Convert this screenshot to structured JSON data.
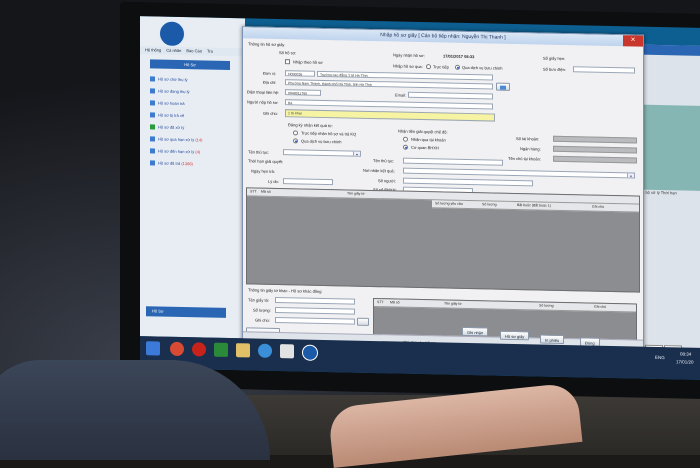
{
  "app": {
    "title": "",
    "menu": [
      "Hệ thống",
      "Cá nhân",
      "Báo Cáo",
      "Tra"
    ],
    "panel_title": "Hồ Sơ",
    "nav_items": [
      {
        "label": "Hồ sơ chờ thụ lý"
      },
      {
        "label": "Hồ sơ đang thụ lý"
      },
      {
        "label": "Hồ sơ hoàn trả"
      },
      {
        "label": "Hồ sơ bị trả về"
      },
      {
        "label": "Hồ sơ đã xử lý"
      },
      {
        "label": "Hồ sơ quá hạn xử lý",
        "badge": "(14)"
      },
      {
        "label": "Hồ sơ đến hạn xử lý",
        "badge": "(4)"
      },
      {
        "label": "Hồ sơ đã trả",
        "badge": "(1366)"
      }
    ],
    "bottom_label": "Hồ Sơ"
  },
  "dialog": {
    "title": "Nhập hồ sơ giấy [ Cán bộ tiếp nhận: Nguyễn Thị Thanh ]",
    "close": "✕",
    "section_info": "Thông tin hồ sơ giấy",
    "so_ho_so_label": "Số hồ sơ:",
    "ngay_nhan_label": "Ngày nhận hồ sơ:",
    "ngay_nhan_value": "17/01/2017 08:33",
    "so_giay_hen_label": "Số giấy hẹn:",
    "nhap_theo_label": "Nhập theo hồ sơ",
    "nhap_hs_qua_label": "Nhập hồ sơ qua:",
    "truc_tiep": "Trực tiếp",
    "qua_dich_vu": "Qua dịch vụ bưu chính",
    "so_buu_dien_label": "Số bưu điện:",
    "don_vi_label": "Đơn vị:",
    "don_vi_code": "H050026",
    "don_vi_name": "Trường cao đẳng Y tế Hà Tĩnh",
    "dia_chi_label": "Địa chỉ:",
    "dia_chi_value": "Phường Nam Thành, thành phố Hà Tĩnh, tỉnh Hà Tĩnh",
    "dien_thoai_label": "Điện thoại liên hệ:",
    "dien_thoai_value": "0948011765",
    "email_label": "Email:",
    "nguoi_nop_label": "Người nộp hồ sơ:",
    "nguoi_nop_value": "Bà",
    "ghi_chu_label": "Ghi chú:",
    "ghi_chu_value": "1 tờ khai",
    "dang_ky_label": "Đăng ký nhận kết quả từ:",
    "opt_truc_tiep_nhan": "Trực tiếp nhận hồ sơ và trả KQ",
    "opt_qua_dich_vu": "Qua dịch vụ bưu chính",
    "nhan_tien_label": "Nhận tiền giải quyết chế độ:",
    "opt_nhan_qua_tk": "Nhận qua tài khoản",
    "opt_co_quan": "Cơ quan BHXH",
    "so_tai_khoan_label": "Số tài khoản:",
    "ngan_hang_label": "Ngân hàng:",
    "ten_chu_tk_label": "Tên chủ tài khoản:",
    "ten_thu_tuc_label": "Tên thủ tục:",
    "thoi_han_label": "Thời hạn giải quyết:",
    "ngay_hen_tra_label": "Ngày hẹn trả:",
    "ly_do_label": "Lý do:",
    "ten_thu_tuc_right_label": "Tên thủ tục:",
    "noi_nhan_label": "Nơi nhận kết quả:",
    "so_nguoi_label": "Số người:",
    "so_bhxh_label": "Số sổ BHXH:",
    "so_the_bhyt_label": "Số thẻ BHYT:",
    "grid1_headers": [
      "STT",
      "Mã số",
      "Tên giấy tờ",
      "Số lượng yêu cầu",
      "Số lượng",
      "Bắt buộc (Bắt buộc 1)",
      "Ghi chú"
    ],
    "section_paper": "Thông tin giấy tờ khác - Hồ sơ khác đồng",
    "ten_giay_to_label": "Tên giấy tờ:",
    "so_luong_label": "Số lượng:",
    "ghi_chu2_label": "Ghi chú:",
    "grid2_headers": [
      "STT",
      "Mã số",
      "Tên giấy tờ",
      "Số lượng",
      "Ghi chú"
    ],
    "them_giay_to": "Thêm giấy tờ",
    "footer_label": "Ghi chú cho hồ sơ",
    "btn_ghi_nhan": "Ghi nhận",
    "btn_ho_so_giay": "Hồ sơ giấy",
    "btn_in_phieu": "In phiếu",
    "btn_dong": "Đóng"
  },
  "right_window": {
    "headers": "Cán bộ xử lý   Thời hạn",
    "page": "15",
    "page2": "1",
    "btn_ghi_ho_so": "Ghi hồ sơ giấy",
    "btn_qua_trinh": "Quá trình xử"
  },
  "taskbar": {
    "lang": "ENG",
    "time": "08:34",
    "date": "17/01/20"
  },
  "colors": {
    "titlebar": "#2a66b4",
    "desktop": "#0d5f91",
    "close": "#c8362c",
    "highlight": "#f6f3a2",
    "taskbar": "#1a2f4d"
  }
}
